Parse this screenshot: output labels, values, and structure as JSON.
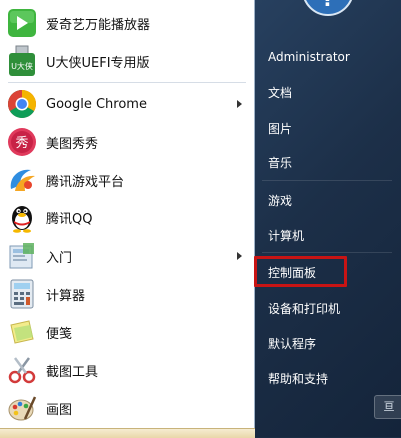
{
  "programs": [
    {
      "label": "爱奇艺万能播放器",
      "icon": "iqiyi-player-icon",
      "has_submenu": false
    },
    {
      "label": "U大侠UEFI专用版",
      "icon": "udaxia-usb-icon",
      "has_submenu": false
    },
    {
      "label": "Google Chrome",
      "icon": "chrome-icon",
      "has_submenu": true
    },
    {
      "label": "美图秀秀",
      "icon": "meitu-icon",
      "has_submenu": false
    },
    {
      "label": "腾讯游戏平台",
      "icon": "tencent-games-icon",
      "has_submenu": false
    },
    {
      "label": "腾讯QQ",
      "icon": "qq-penguin-icon",
      "has_submenu": false
    },
    {
      "label": "入门",
      "icon": "getting-started-icon",
      "has_submenu": true
    },
    {
      "label": "计算器",
      "icon": "calculator-icon",
      "has_submenu": false
    },
    {
      "label": "便笺",
      "icon": "sticky-notes-icon",
      "has_submenu": false
    },
    {
      "label": "截图工具",
      "icon": "snipping-tool-icon",
      "has_submenu": false
    },
    {
      "label": "画图",
      "icon": "paint-icon",
      "has_submenu": false
    }
  ],
  "udaxia_icon_text": "U大侠",
  "meitu_icon_text": "秀",
  "right_menu": {
    "user": "Administrator",
    "items": [
      "文档",
      "图片",
      "音乐",
      "游戏",
      "计算机",
      "控制面板",
      "设备和打印机",
      "默认程序",
      "帮助和支持"
    ]
  },
  "highlighted_item": "控制面板",
  "highlight_color": "#c81414",
  "shutdown_hint": "亘"
}
